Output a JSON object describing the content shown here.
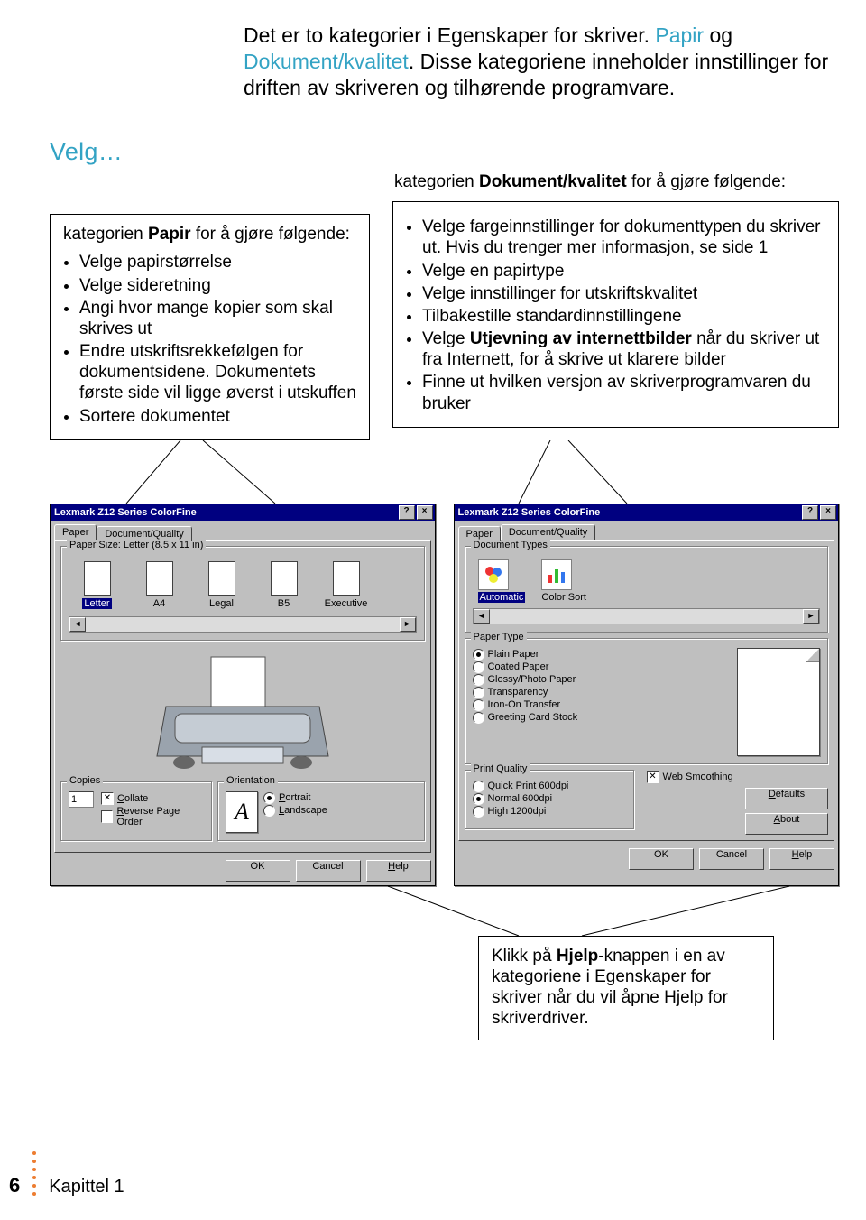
{
  "velg": "Velg…",
  "intro": {
    "pre": "Det er to kategorier i Egenskaper for skriver. ",
    "papir": "Papir",
    "mid": " og ",
    "dq": "Dokument/kvalitet",
    "post": ". Disse kategoriene inneholder innstillinger for driften av skriveren og tilhørende programvare."
  },
  "left_callout": {
    "lead_pre": "kategorien ",
    "lead_bold": "Papir",
    "lead_post": " for å gjøre følgende:",
    "items": [
      "Velge papirstørrelse",
      "Velge sideretning",
      "Angi hvor mange kopier som skal skrives ut",
      "Endre utskriftsrekkefølgen for dokumentsidene. Dokumentets første side vil ligge øverst i utskuffen",
      "Sortere dokumentet"
    ]
  },
  "right_lead": {
    "pre": "kategorien ",
    "bold": "Dokument/kvalitet",
    "post": " for å gjøre følgende:"
  },
  "right_callout": {
    "items_pre_bold": [
      "Velge fargeinnstillinger for dokumenttypen du skriver ut. Hvis du trenger mer informasjon, se side 1",
      "Velge en papirtype",
      "Velge innstillinger for utskriftskvalitet",
      "Tilbakestille standardinnstillingene"
    ],
    "utjevning_pre": "Velge ",
    "utjevning_bold": "Utjevning av internettbilder",
    "utjevning_post": " når du skriver ut fra Internett, for å skrive ut klarere bilder",
    "items_post": [
      "Finne ut hvilken versjon av skriverprogramvaren du bruker"
    ]
  },
  "dialog": {
    "title": "Lexmark Z12 Series ColorFine",
    "help_btn": "?",
    "close_btn": "×",
    "tabs": {
      "paper": "Paper",
      "dq": "Document/Quality"
    },
    "paper_size_label": "Paper Size: Letter (8.5 x 11 in)",
    "sizes": [
      "Letter",
      "A4",
      "Legal",
      "B5",
      "Executive"
    ],
    "copies_label": "Copies",
    "copies_value": "1",
    "collate": "Collate",
    "reverse": "Reverse Page Order",
    "orientation_label": "Orientation",
    "portrait": "Portrait",
    "landscape": "Landscape",
    "ok": "OK",
    "cancel": "Cancel",
    "help": "Help",
    "doc_types_label": "Document Types",
    "doc_types": {
      "auto": "Automatic",
      "color": "Color Sort"
    },
    "paper_type_label": "Paper Type",
    "paper_types": [
      "Plain Paper",
      "Coated Paper",
      "Glossy/Photo Paper",
      "Transparency",
      "Iron-On Transfer",
      "Greeting Card Stock"
    ],
    "print_quality_label": "Print Quality",
    "pq": [
      "Quick Print 600dpi",
      "Normal 600dpi",
      "High 1200dpi"
    ],
    "web_smoothing": "Web Smoothing",
    "defaults": "Defaults",
    "about": "About",
    "orientA": "A"
  },
  "help_callout": {
    "pre": "Klikk på ",
    "bold": "Hjelp",
    "post": "-knappen i en av kategoriene i Egenskaper for skriver når du vil åpne Hjelp for skriverdriver."
  },
  "footer": {
    "page": "6",
    "chapter": "Kapittel 1"
  }
}
